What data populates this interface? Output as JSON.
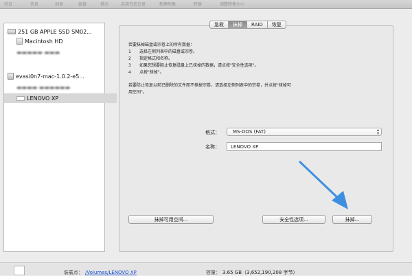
{
  "toolbar": {
    "items": [
      "验证",
      "信息",
      "刻录",
      "装载",
      "推出",
      "启用日志记录",
      "新建映像",
      "转换",
      "调整映像大小"
    ]
  },
  "sidebar": {
    "items": [
      {
        "label": "251 GB APPLE SSD SM02...",
        "icon": "internal-disk-icon"
      },
      {
        "label": "Macintosh HD",
        "icon": "volume-icon"
      },
      {
        "label": "",
        "icon": "blurred-item"
      },
      {
        "label": "evasi0n7-mac-1.0.2-e5...",
        "icon": "disk-image-icon"
      },
      {
        "label": "",
        "icon": "blurred-item"
      },
      {
        "label": "LENOVO XP",
        "icon": "usb-volume-icon"
      }
    ]
  },
  "tabs": [
    {
      "label": "急救"
    },
    {
      "label": "抹掉"
    },
    {
      "label": "RAID"
    },
    {
      "label": "恢复"
    }
  ],
  "active_tab": "抹掉",
  "instructions": {
    "heading": "若要抹掉磁盘或宗卷上的所有数据：",
    "steps": [
      {
        "num": "1",
        "text": "选择左侧列表中的磁盘或宗卷。"
      },
      {
        "num": "2",
        "text": "指定格式和名称。"
      },
      {
        "num": "3",
        "text": "如果您想要阻止恢复磁盘上已抹掉的数据，请点按\"安全性选项\"。"
      },
      {
        "num": "4",
        "text": "点按\"抹掉\"。"
      }
    ],
    "note_line1": "若要防止恢复以前已删除的文件而不抹掉宗卷，请选择左侧列表中的宗卷，并点按\"抹掉可",
    "note_line2": "用空间\"。"
  },
  "form": {
    "format_label": "格式：",
    "format_value": "MS-DOS (FAT)",
    "name_label": "名称：",
    "name_value": "LENOVO XP"
  },
  "buttons": {
    "erase_free_space": "抹掉可用空间...",
    "security_options": "安全性选项...",
    "erase": "抹掉..."
  },
  "bottom": {
    "mount_label": "装载点：",
    "mount_value": "/Volumes/LENOVO XP",
    "capacity_label": "容量：",
    "capacity_value": "3.65 GB（3,652,190,208 字节）"
  },
  "colors": {
    "arrow": "#3f8fe0",
    "link": "#1a4fd0",
    "active_tab": "#8f8f8f"
  }
}
